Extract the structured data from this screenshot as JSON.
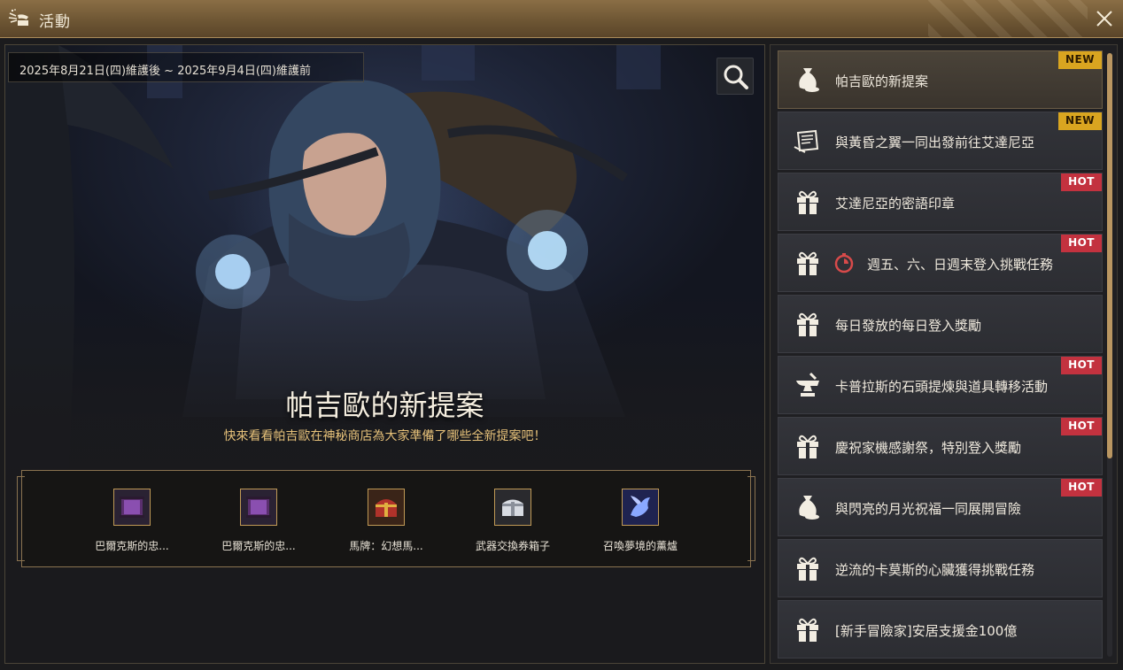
{
  "window": {
    "title": "活動",
    "close_icon": "close-icon"
  },
  "banner": {
    "date_range": "2025年8月21日(四)維護後 ~ 2025年9月4日(四)維護前",
    "title": "帕吉歐的新提案",
    "subtitle": "快來看看帕吉歐在神秘商店為大家準備了哪些全新提案吧！",
    "search_icon": "search-icon"
  },
  "rewards": [
    {
      "label": "巴爾克斯的忠...",
      "icon": "scroll-icon"
    },
    {
      "label": "巴爾克斯的忠...",
      "icon": "scroll-icon"
    },
    {
      "label": "馬牌：幻想馬...",
      "icon": "chest-icon"
    },
    {
      "label": "武器交換券箱子",
      "icon": "box-icon"
    },
    {
      "label": "召喚夢境的薰爐",
      "icon": "dragon-icon"
    }
  ],
  "events": [
    {
      "name": "帕吉歐的新提案",
      "badge": "NEW",
      "icon": "money-bag-icon"
    },
    {
      "name": "與黃昏之翼一同出發前往艾達尼亞",
      "badge": "NEW",
      "icon": "letter-icon"
    },
    {
      "name": "艾達尼亞的密語印章",
      "badge": "HOT",
      "icon": "gift-icon"
    },
    {
      "name": "週五、六、日週末登入挑戰任務",
      "badge": "HOT",
      "icon": "gift-icon"
    },
    {
      "name": "每日發放的每日登入獎勵",
      "badge": "",
      "icon": "gift-icon"
    },
    {
      "name": "卡普拉斯的石頭提煉與道具轉移活動",
      "badge": "HOT",
      "icon": "anvil-icon"
    },
    {
      "name": "慶祝家機感謝祭，特別登入獎勵",
      "badge": "HOT",
      "icon": "gift-icon"
    },
    {
      "name": "與閃亮的月光祝福一同展開冒險",
      "badge": "HOT",
      "icon": "money-bag-icon"
    },
    {
      "name": "逆流的卡莫斯的心臟獲得挑戰任務",
      "badge": "",
      "icon": "gift-icon"
    },
    {
      "name": "[新手冒險家]安居支援金100億",
      "badge": "",
      "icon": "gift-icon"
    }
  ],
  "colors": {
    "accent_gold": "#d9a520",
    "hot_red": "#c3323f",
    "title_bar": "#6e5634"
  }
}
